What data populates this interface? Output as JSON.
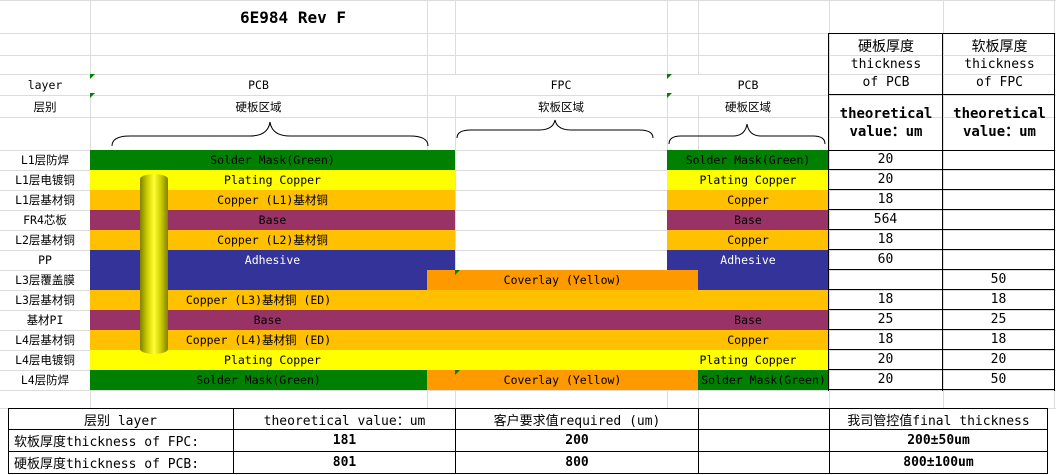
{
  "title": "6E984 Rev F",
  "header": {
    "layer_en": "layer",
    "layer_cn": "层别",
    "pcb_left": "PCB",
    "pcb_left_cn": "硬板区域",
    "fpc": "FPC",
    "fpc_cn": "软板区域",
    "pcb_right": "PCB",
    "pcb_right_cn": "硬板区域",
    "hard_thk": [
      "硬板厚度",
      "thickness",
      "of PCB"
    ],
    "soft_thk": [
      "软板厚度",
      "thickness",
      "of FPC"
    ],
    "theo_label": [
      "theoretical",
      "value：um"
    ],
    "theo_label2": [
      "theoretical",
      "value：um"
    ]
  },
  "rows": [
    {
      "name": "L1层防焊",
      "left": "Solder Mask(Green)",
      "right": "Solder Mask(Green)",
      "pcb": "20",
      "fpc": ""
    },
    {
      "name": "L1层电镀铜",
      "left": "Plating Copper",
      "right": "Plating Copper",
      "pcb": "20",
      "fpc": ""
    },
    {
      "name": "L1层基材铜",
      "left": "Copper (L1)基材铜",
      "right": "Copper",
      "pcb": "18",
      "fpc": ""
    },
    {
      "name": "FR4芯板",
      "left": "Base",
      "right": "Base",
      "pcb": "564",
      "fpc": ""
    },
    {
      "name": "L2层基材铜",
      "left": "Copper (L2)基材铜",
      "right": "Copper",
      "pcb": "18",
      "fpc": ""
    },
    {
      "name": "PP",
      "left": "Adhesive",
      "right": "Adhesive",
      "pcb": "60",
      "fpc": ""
    },
    {
      "name": "L3层覆盖膜",
      "left": "Coverlay (Yellow)",
      "right": "",
      "pcb": "",
      "fpc": "50"
    },
    {
      "name": "L3层基材铜",
      "left": "Copper (L3)基材铜 (ED)",
      "right": "",
      "pcb": "18",
      "fpc": "18"
    },
    {
      "name": "基材PI",
      "left": "Base",
      "right": "Base",
      "pcb": "25",
      "fpc": "25"
    },
    {
      "name": "L4层基材铜",
      "left": "Copper (L4)基材铜 (ED)",
      "right": "Copper",
      "pcb": "18",
      "fpc": "18"
    },
    {
      "name": "L4层电镀铜",
      "left": "Plating Copper",
      "right": "Plating Copper",
      "pcb": "20",
      "fpc": "20"
    },
    {
      "name": "L4层防焊",
      "left": "Solder Mask(Green)",
      "mid": "Coverlay (Yellow)",
      "right": "Solder Mask(Green)",
      "pcb": "20",
      "fpc": "50"
    }
  ],
  "summary": {
    "headers": [
      "层别 layer",
      "theoretical value：um",
      "客户要求值required (um)",
      "",
      "我司管控值final thickness"
    ],
    "rows": [
      {
        "label": "软板厚度thickness of FPC:",
        "theo": "181",
        "req": "200",
        "final": "200±50um"
      },
      {
        "label": "硬板厚度thickness of PCB:",
        "theo": "801",
        "req": "800",
        "final": "800±100um"
      }
    ]
  },
  "colors": {
    "solder_mask": "#008000",
    "plating": "#ffff00",
    "copper": "#ffc000",
    "base": "#993366",
    "adhesive": "#333399",
    "coverlay": "#ff9900"
  }
}
